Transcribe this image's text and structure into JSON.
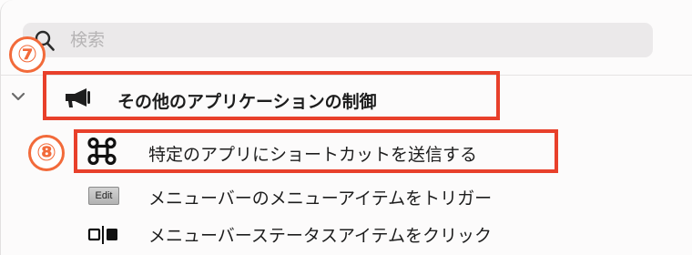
{
  "search": {
    "placeholder": "検索",
    "value": ""
  },
  "callouts": {
    "badge_7": "⑦",
    "badge_8": "⑧",
    "color": "#e8402b"
  },
  "category": {
    "label": "その他のアプリケーションの制御",
    "icon": "megaphone-icon",
    "expanded": true
  },
  "actions": [
    {
      "label": "特定のアプリにショートカットを送信する",
      "icon": "command-key-icon"
    },
    {
      "label": "メニューバーのメニューアイテムをトリガー",
      "icon": "edit-icon",
      "icon_text": "Edit"
    },
    {
      "label": "メニューバーステータスアイテムをクリック",
      "icon": "status-item-icon"
    }
  ]
}
